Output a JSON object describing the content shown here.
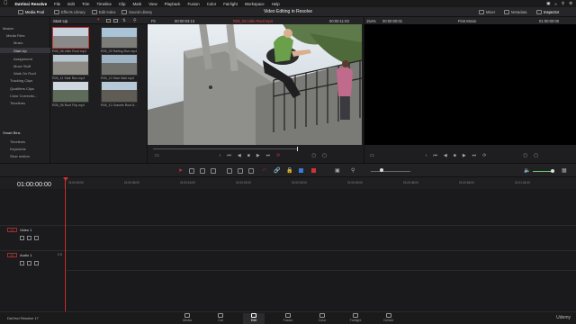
{
  "menubar": {
    "app": "DaVinci Resolve",
    "items": [
      "File",
      "Edit",
      "Trim",
      "Timeline",
      "Clip",
      "Mark",
      "View",
      "Playback",
      "Fusion",
      "Color",
      "Fairlight",
      "Workspace",
      "Help"
    ]
  },
  "toolbar": {
    "media_pool": "Media Pool",
    "effects": "Effects Library",
    "edit_index": "Edit Index",
    "sound_library": "Sound Library",
    "project_title": "Video Editing in Resolve",
    "mixer": "Mixer",
    "metadata": "Metadata",
    "inspector": "Inspector"
  },
  "media_pool": {
    "bin": "Start Up",
    "tree": [
      "Master",
      "Media Files",
      "Music",
      "Start Up",
      "Assignment",
      "Move Stuff",
      "Walk On Roof",
      "Tracking Clips",
      "Qualifiers Clips",
      "Color Correctio...",
      "Timelines"
    ],
    "smart_bins_title": "Smart Bins",
    "smart_bins": [
      "Timelines",
      "Keywords",
      "Slow motion"
    ],
    "clips": [
      {
        "label": "R05_08 Little Roof.mp4"
      },
      {
        "label": "R05_09 Railing Run.mp4"
      },
      {
        "label": "R05_11 Stair Run.mp4"
      },
      {
        "label": "R05_10 Stair Wall.mp4"
      },
      {
        "label": "R05_06 Roof Flip.mp4"
      },
      {
        "label": "R05_11 Gravels Roof 8..."
      }
    ]
  },
  "source_viewer": {
    "zoom": "Fit",
    "timecode_left": "00:00:03:13",
    "clip_name": "R05_08 Little Roof.mp4",
    "timecode_right": "00:00:11:03"
  },
  "record_viewer": {
    "zoom": "154%",
    "timecode_left": "00:00:00:01",
    "timeline_name": "First Movie",
    "timecode_right": "01:00:00:00"
  },
  "timeline": {
    "timecode": "01:00:00:00",
    "ruler": [
      "01:00:00:00",
      "01:00:08:00",
      "01:00:16:00",
      "01:00:24:00",
      "01:00:32:00",
      "01:00:40:00",
      "01:00:48:00",
      "01:00:56:00",
      "01:01:04:00"
    ],
    "tracks": [
      {
        "badge": "V1",
        "name": "Video 1"
      },
      {
        "badge": "A1",
        "name": "Audio 1",
        "level": "2.0"
      }
    ]
  },
  "pages": [
    {
      "label": "Media",
      "icon": "media-icon"
    },
    {
      "label": "Cut",
      "icon": "cut-icon"
    },
    {
      "label": "Edit",
      "icon": "edit-icon"
    },
    {
      "label": "Fusion",
      "icon": "fusion-icon"
    },
    {
      "label": "Color",
      "icon": "color-icon"
    },
    {
      "label": "Fairlight",
      "icon": "fairlight-icon"
    },
    {
      "label": "Deliver",
      "icon": "deliver-icon"
    }
  ],
  "brand": "DaVinci Resolve 17",
  "watermark": "Udemy",
  "colors": {
    "accent_red": "#d23232",
    "playhead": "#d23232"
  }
}
